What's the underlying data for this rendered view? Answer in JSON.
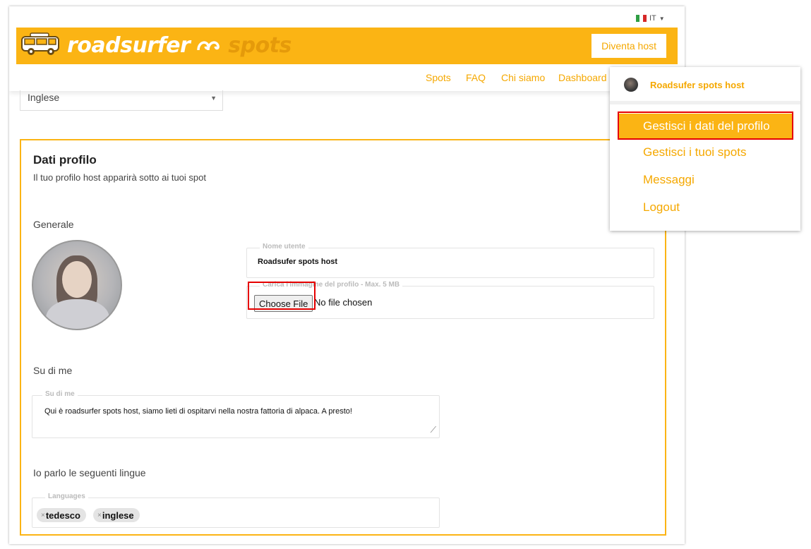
{
  "header": {
    "lang_code": "IT",
    "brand_part1": "roadsurfer",
    "brand_part2": "spots",
    "host_button": "Diventa host"
  },
  "nav": {
    "items": [
      "Spots",
      "FAQ",
      "Chi siamo",
      "Dashboard"
    ]
  },
  "language_select": {
    "value": "Inglese"
  },
  "profile": {
    "title": "Dati profilo",
    "subtitle": "Il tuo profilo host apparirà sotto ai tuoi spot",
    "general_label": "Generale",
    "username_legend": "Nome utente",
    "username_value": "Roadsufer spots host",
    "upload_legend": "Carica l'immagine del profilo - Max. 5 MB",
    "choose_file": "Choose File",
    "no_file": "No file chosen",
    "about_label": "Su di me",
    "about_legend": "Su di me",
    "about_value": "Qui è roadsurfer spots host, siamo lieti di ospitarvi nella nostra fattoria di alpaca. A presto!",
    "languages_label": "Io parlo le seguenti lingue",
    "languages_legend": "Languages",
    "languages": [
      "tedesco",
      "inglese"
    ],
    "chip_remove": "×"
  },
  "dropdown": {
    "user_name": "Roadsufer spots host",
    "items": [
      "Gestisci i dati del profilo",
      "Gestisci i tuoi spots",
      "Messaggi",
      "Logout"
    ]
  },
  "colors": {
    "brand": "#fbb414",
    "link": "#f5a800",
    "highlight": "#e60000"
  },
  "icons": [
    "italy-flag-icon",
    "caret-down-icon",
    "van-logo-icon",
    "wave-logo-icon",
    "resize-handle-icon"
  ]
}
